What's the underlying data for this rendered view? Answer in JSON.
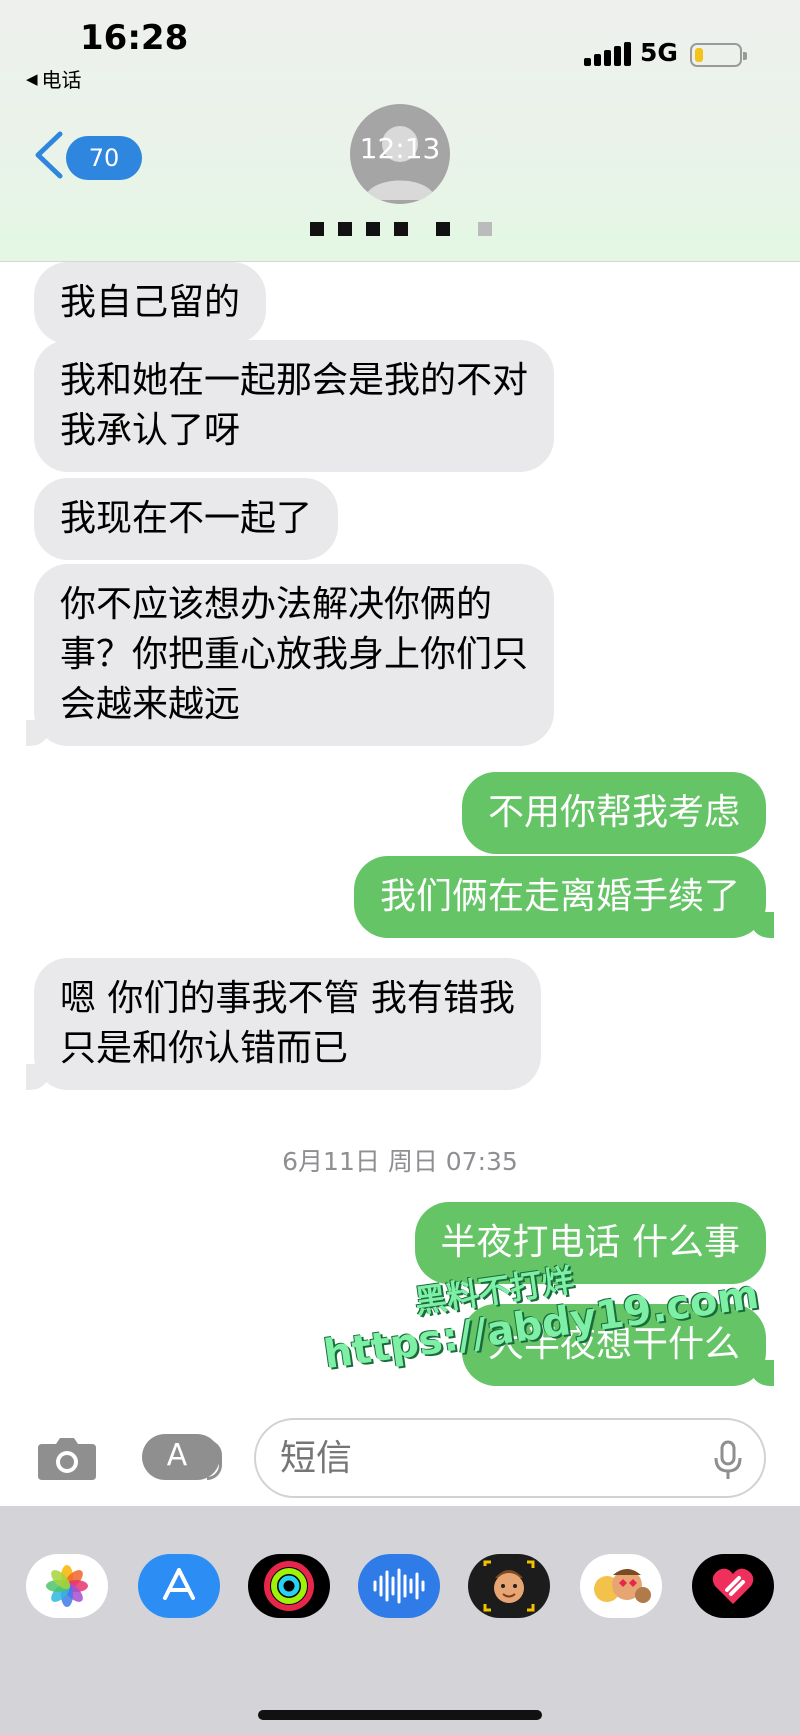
{
  "status_bar": {
    "time": "16:28",
    "back_app": "电话",
    "network": "5G"
  },
  "header": {
    "unread_count": "70",
    "avatar_text": "12:13"
  },
  "messages": [
    {
      "dir": "in",
      "lines": [
        "我自己留的"
      ]
    },
    {
      "dir": "in",
      "lines": [
        "我和她在一起那会是我的不对",
        "我承认了呀"
      ]
    },
    {
      "dir": "in",
      "lines": [
        "我现在不一起了"
      ]
    },
    {
      "dir": "in",
      "lines": [
        "你不应该想办法解决你俩的",
        "事？你把重心放我身上你们只",
        "会越来越远"
      ]
    },
    {
      "dir": "out",
      "lines": [
        "不用你帮我考虑"
      ]
    },
    {
      "dir": "out",
      "lines": [
        "我们俩在走离婚手续了"
      ]
    },
    {
      "dir": "in",
      "lines": [
        "嗯 你们的事我不管 我有错我",
        "只是和你认错而已"
      ]
    },
    {
      "dir": "out",
      "lines": [
        "半夜打电话 什么事"
      ]
    },
    {
      "dir": "out",
      "lines": [
        "大半夜想干什么"
      ]
    }
  ],
  "timestamp": "6月11日 周日 07:35",
  "watermark": {
    "line1": "黑料不打烊",
    "line2": "https://abdy19.com"
  },
  "input": {
    "placeholder": "短信"
  },
  "apps": [
    "photos-icon",
    "app-store-icon",
    "activity-icon",
    "audio-message-icon",
    "memoji-icon",
    "memoji-stickers-icon",
    "digital-touch-icon"
  ],
  "colors": {
    "outgoing": "#65c466",
    "incoming": "#e9e9eb",
    "badge": "#2e86de"
  }
}
